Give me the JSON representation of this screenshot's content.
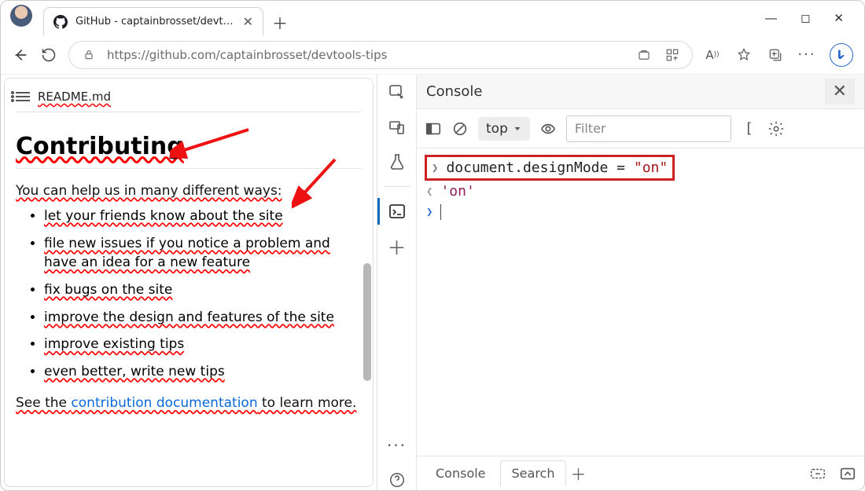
{
  "browser": {
    "tab_title": "GitHub - captainbrosset/devtool",
    "url_display": "https://github.com/captainbrosset/devtools-tips"
  },
  "page": {
    "filename": "README.md",
    "heading": "Contributing",
    "intro": "You can help us in many different ways:",
    "bullets": [
      "let your friends know about the site",
      "file new issues if you notice a problem and have an idea for a new feature",
      "fix bugs on the site",
      "improve the design and features of the site",
      "improve existing tips",
      "even better, write new tips"
    ],
    "outro_pre": "See the ",
    "outro_link": "contribution documentation",
    "outro_post": " to learn more."
  },
  "devtools": {
    "panel_title": "Console",
    "context": "top",
    "filter_placeholder": "Filter",
    "input_code_pre": "document.designMode = ",
    "input_code_str": "\"on\"",
    "output": "'on'",
    "drawer_tabs": {
      "console": "Console",
      "search": "Search"
    }
  }
}
